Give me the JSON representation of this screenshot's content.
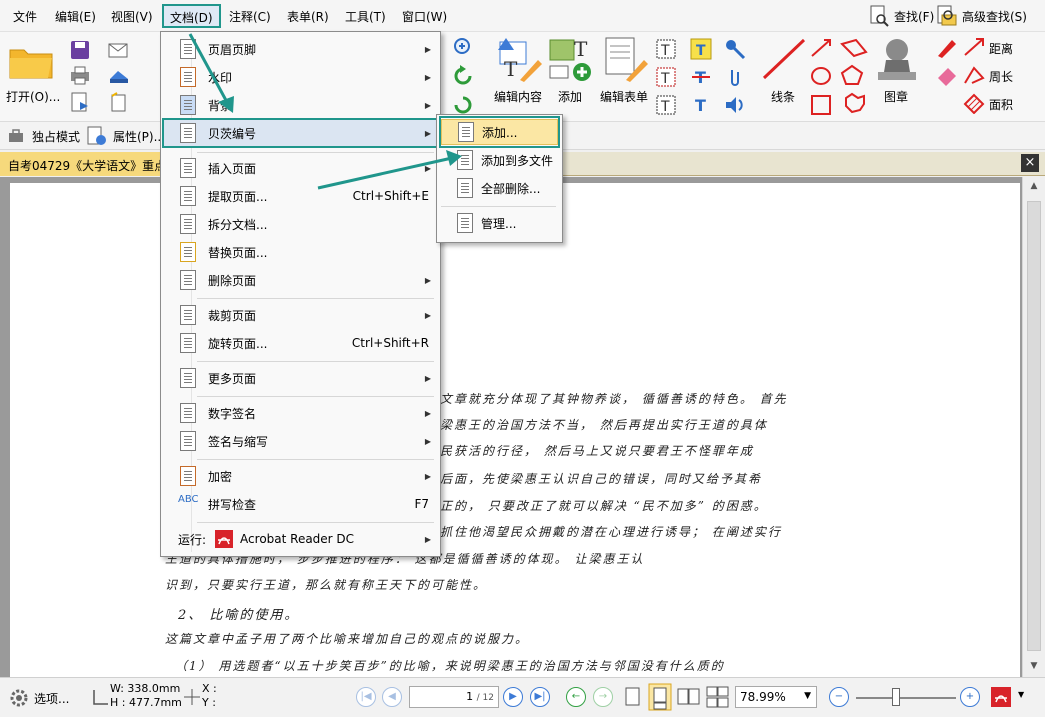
{
  "menubar": {
    "items": [
      "文件",
      "编辑(E)",
      "视图(V)",
      "文档(D)",
      "注释(C)",
      "表单(R)",
      "工具(T)",
      "窗口(W)"
    ],
    "find": "查找(F)",
    "advanced_find": "高级查找(S)"
  },
  "ribbon": {
    "open": "打开(O)...",
    "edit_content": "编辑内容",
    "add": "添加",
    "edit_form": "编辑表单",
    "lines": "线条",
    "stamp": "图章",
    "distance": "距离",
    "perimeter": "周长",
    "area": "面积"
  },
  "subbar": {
    "exclusive_mode": "独占模式",
    "properties": "属性(P)..."
  },
  "doc_tab": {
    "title": "自考04729《大学语文》重点",
    "close": "×"
  },
  "doc_menu": {
    "items": [
      {
        "label": "页眉页脚",
        "submenu": true
      },
      {
        "label": "水印",
        "submenu": true
      },
      {
        "label": "背景",
        "submenu": true
      },
      {
        "label": "贝茨编号",
        "submenu": true
      },
      {
        "label": "插入页面",
        "submenu": true
      },
      {
        "label": "提取页面...",
        "shortcut": "Ctrl+Shift+E"
      },
      {
        "label": "拆分文档..."
      },
      {
        "label": "替换页面..."
      },
      {
        "label": "删除页面",
        "submenu": true
      },
      {
        "label": "裁剪页面",
        "submenu": true
      },
      {
        "label": "旋转页面...",
        "shortcut": "Ctrl+Shift+R"
      },
      {
        "label": "更多页面",
        "submenu": true
      },
      {
        "label": "数字签名",
        "submenu": true
      },
      {
        "label": "签名与缩写",
        "submenu": true
      },
      {
        "label": "加密",
        "submenu": true
      },
      {
        "label": "拼写检查",
        "shortcut": "F7"
      },
      {
        "label": "运行:",
        "sublabel": "Acrobat Reader DC",
        "submenu": true
      }
    ]
  },
  "bates_menu": {
    "items": [
      "添加...",
      "添加到多文件",
      "全部删除...",
      "管理..."
    ]
  },
  "document_lines": [
    "文章就充分体现了其钟物养谈，    循循善诱的特色。   首先",
    "梁惠王的治国方法不当，      然后再提出实行王道的具体",
    "民获活的行径，       然后马上又说只要君王不怪罪年成",
    "后面，先使梁惠王认识自己的错误，同时又给予其希",
    "正的，     只要改正了就可以解决  “民不加多” 的困惑。",
    "抓住他渴望民众拥戴的潜在心理进行诱导；    在阐述实行",
    "王道的具体措施时，    步步推进的程序：  这都是循循善诱的体现。   让梁惠王认",
    "识到，只要实行王道，那么就有称王天下的可能性。",
    "2、 比喻的使用。",
    "这篇文章中孟子用了两个比喻来增加自己的观点的说服力。",
    "（1） 用选题者“以五十步笑百步”的比喻，来说明梁惠王的治国方法与邻国没有什么质的"
  ],
  "status": {
    "options": "选项...",
    "width": "W: 338.0mm",
    "height": "H : 477.7mm",
    "x": "X :",
    "y": "Y :",
    "page_current": "1",
    "page_total": "/ 12",
    "zoom": "78.99%"
  },
  "colors": {
    "annotation": "#20968c",
    "highlight": "#fbe7a4",
    "tab": "#f6d97c"
  }
}
